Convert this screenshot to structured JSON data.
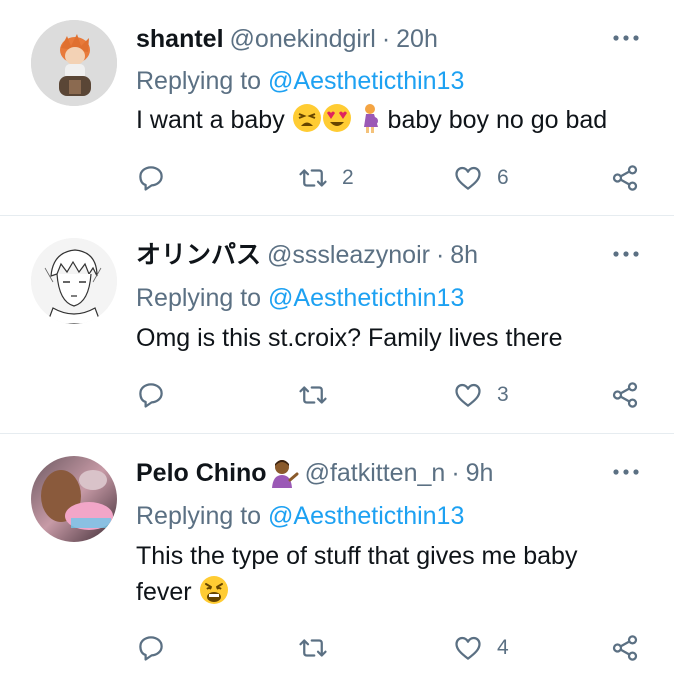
{
  "tweets": [
    {
      "name": "shantel",
      "handle": "@onekindgirl",
      "dot": "·",
      "time": "20h",
      "replying_prefix": "Replying to ",
      "replying_to": "@Aestheticthin13",
      "text_before": "I want a baby ",
      "text_after": " baby boy no go bad",
      "emojis": [
        "tired-face",
        "heart-eyes",
        "pregnant-woman"
      ],
      "retweets": "2",
      "likes": "6",
      "avatar": "anime-character-avatar"
    },
    {
      "name": "オリンパス",
      "handle": "@sssleazynoir",
      "dot": "·",
      "time": "8h",
      "replying_prefix": "Replying to ",
      "replying_to": "@Aestheticthin13",
      "text": "Omg is this st.croix? Family lives there",
      "retweets": "",
      "likes": "3",
      "avatar": "manga-sketch-avatar"
    },
    {
      "name": "Pelo Chino",
      "handle": "@fatkitten_n",
      "dot": "·",
      "time": "9h",
      "replying_prefix": "Replying to ",
      "replying_to": "@Aestheticthin13",
      "text_line1": "This the type of stuff that gives me baby",
      "text_line2": "fever ",
      "emojis": [
        "person-tipping-hand",
        "weary-face"
      ],
      "retweets": "",
      "likes": "4",
      "avatar": "photo-avatar"
    }
  ],
  "colors": {
    "text": "#0f1419",
    "muted": "#5b7083",
    "link": "#1da1f2",
    "divider": "#e6ecf0"
  },
  "icons": [
    "reply-icon",
    "retweet-icon",
    "like-icon",
    "share-icon",
    "more-icon"
  ]
}
